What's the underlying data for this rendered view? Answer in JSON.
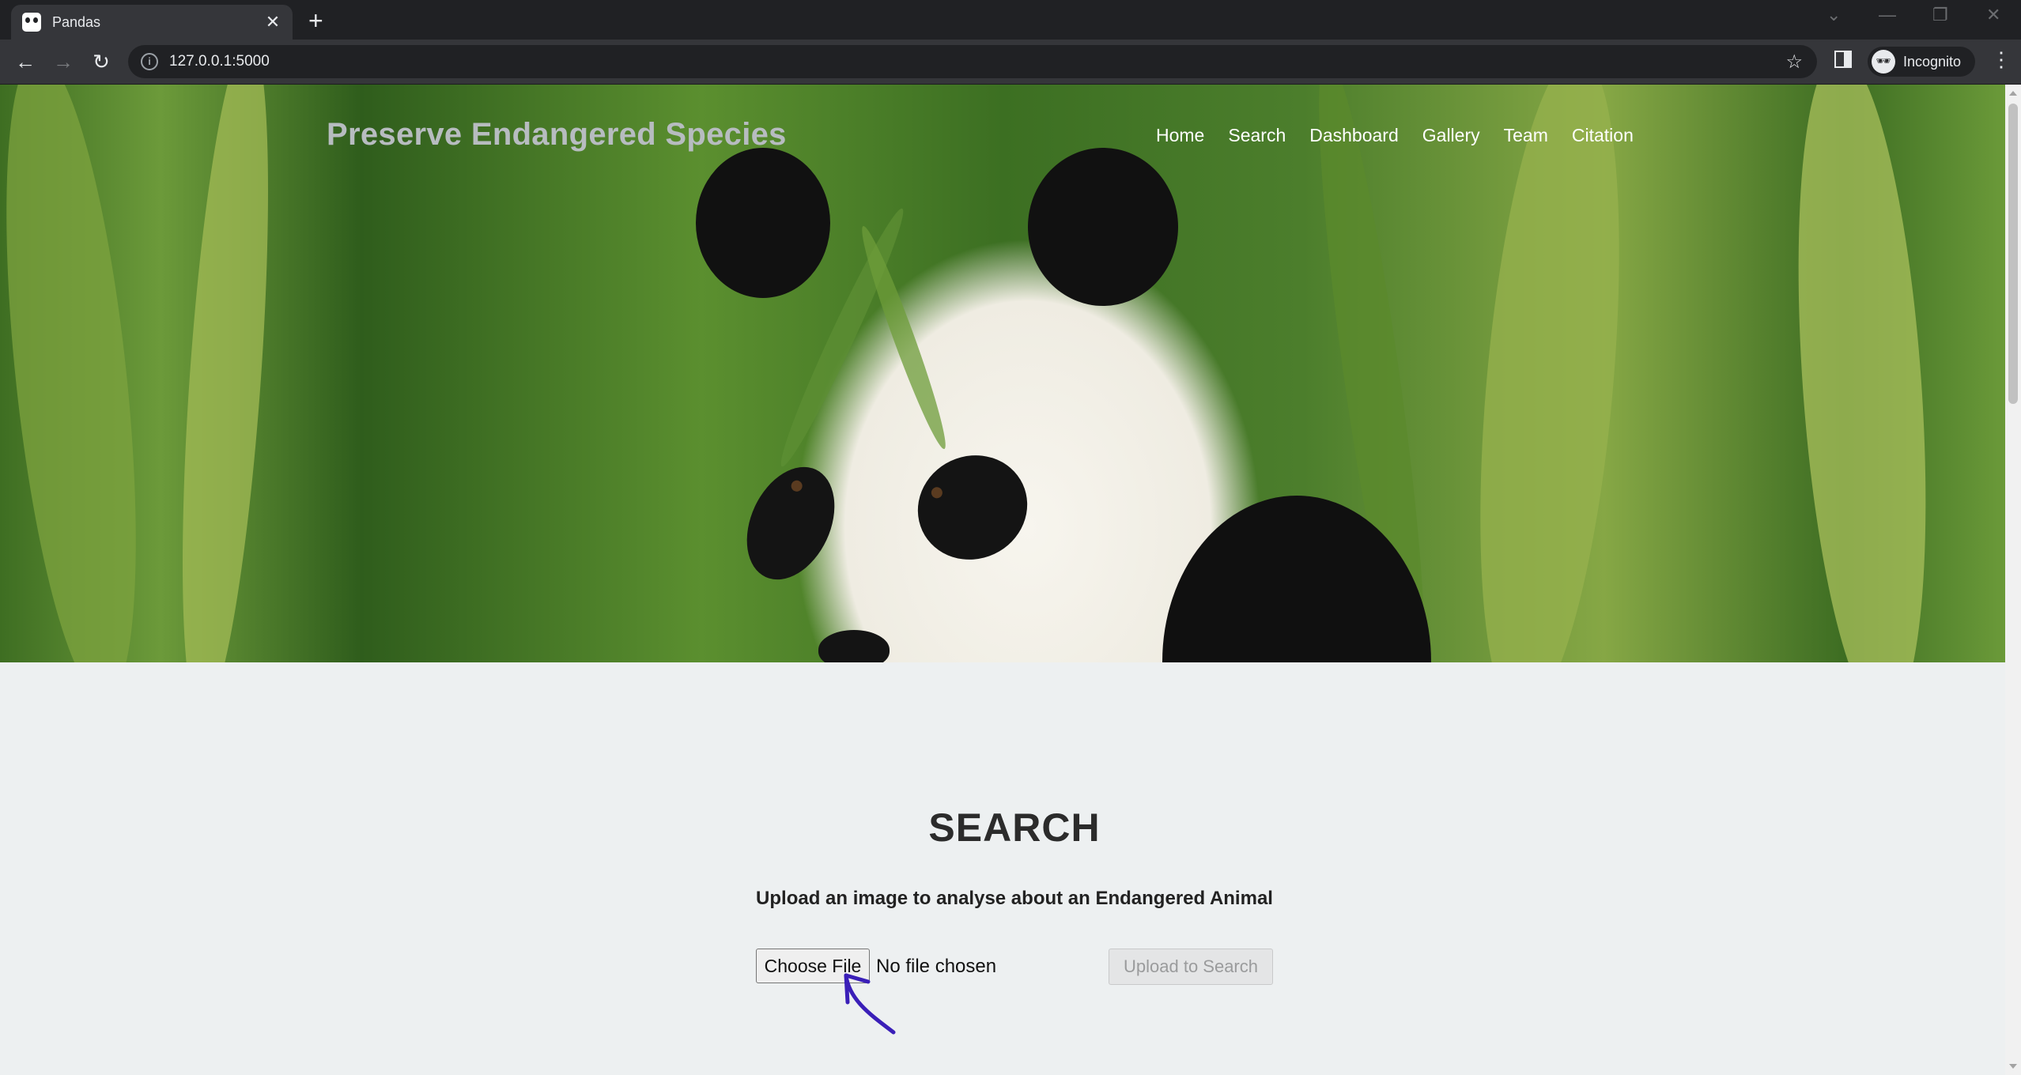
{
  "browser": {
    "tab_title": "Pandas",
    "tab_close": "✕",
    "new_tab": "+",
    "url": "127.0.0.1:5000",
    "profile_label": "Incognito",
    "icons": {
      "back": "←",
      "forward": "→",
      "reload": "↻",
      "info": "i",
      "star": "☆",
      "menu": "⋮",
      "incognito": "🕶",
      "tab_search": "⌄",
      "minimize": "—",
      "restore": "❐",
      "close": "✕"
    }
  },
  "header": {
    "brand": "Preserve Endangered Species",
    "nav": [
      "Home",
      "Search",
      "Dashboard",
      "Gallery",
      "Team",
      "Citation"
    ]
  },
  "search": {
    "heading": "SEARCH",
    "subtitle": "Upload an image to analyse about an Endangered Animal",
    "choose_file_label": "Choose File",
    "file_status": "No file chosen",
    "upload_button": "Upload to Search"
  },
  "colors": {
    "annotation_arrow": "#3a1fb8",
    "brand_text": "#b7bcc0",
    "page_background": "#edf0f1"
  }
}
